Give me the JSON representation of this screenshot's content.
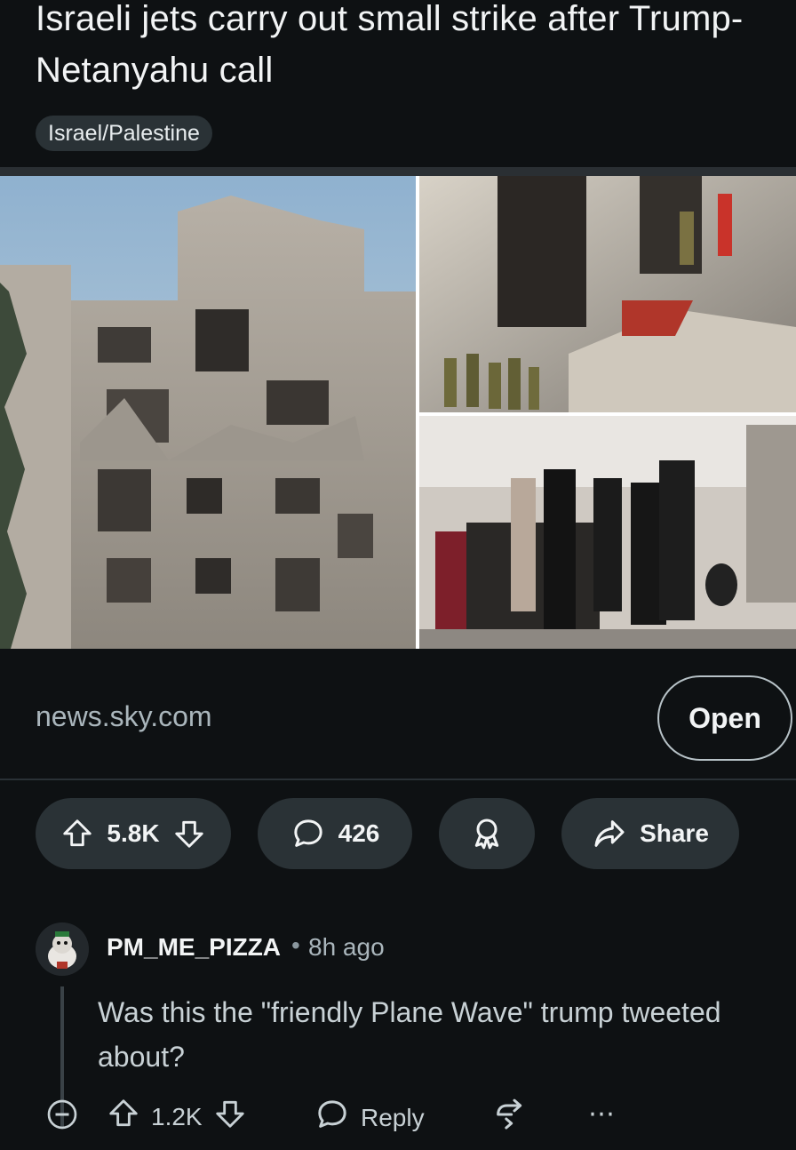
{
  "post": {
    "title": "Israeli jets carry out small strike after Trump-Netanyahu call",
    "flair": "Israel/Palestine"
  },
  "link": {
    "domain": "news.sky.com",
    "open_label": "Open"
  },
  "actions": {
    "score": "5.8K",
    "comments": "426",
    "share_label": "Share"
  },
  "comment": {
    "author": "PM_ME_PIZZA",
    "separator": "•",
    "time": "8h ago",
    "body": "Was this the \"friendly Plane Wave\" trump tweeted about?",
    "score": "1.2K",
    "reply_label": "Reply",
    "more": "⋯"
  },
  "icons": {
    "upvote": "upvote-icon",
    "downvote": "downvote-icon",
    "comment": "comment-bubble-icon",
    "award": "award-icon",
    "share": "share-arrow-icon",
    "collapse": "collapse-icon",
    "reply": "reply-bubble-icon",
    "crosspost": "crosspost-icon",
    "more": "more-dots-icon"
  },
  "colors": {
    "background": "#0e1113",
    "pill": "#2a3236",
    "text": "#f2f4f5",
    "muted": "#aab6bc"
  }
}
